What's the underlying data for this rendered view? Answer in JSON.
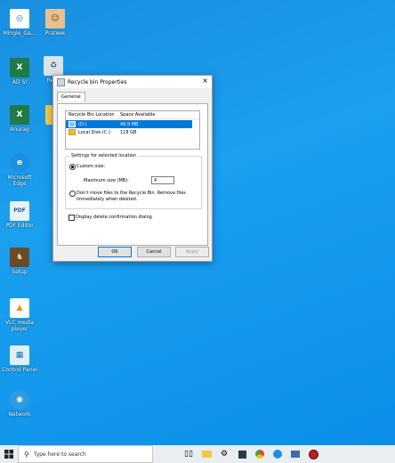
{
  "desktop": {
    "icons": [
      {
        "label": "Mingle_Ga...",
        "glyph": "◎",
        "color": "#ffffff",
        "fg": "#1a6fb5"
      },
      {
        "label": "Prateek",
        "glyph": "☺",
        "color": "#e8c090",
        "fg": "#5a3a1a"
      },
      {
        "label": "AD SI",
        "glyph": "X",
        "color": "#1f7a45",
        "fg": "#ffffff"
      },
      {
        "label": "Recy",
        "glyph": "♻",
        "color": "#d8e4ea",
        "fg": "#556"
      },
      {
        "label": "Anurag",
        "glyph": "X",
        "color": "#1f7a45",
        "fg": "#ffffff"
      },
      {
        "label": "",
        "glyph": "",
        "color": "#f2c94c",
        "fg": "#f2c94c"
      },
      {
        "label": "Microsoft Edge",
        "glyph": "e",
        "color": "#1e8fe0",
        "fg": "#ffffff"
      },
      {
        "label": "PDF Editor",
        "glyph": "PDF",
        "color": "#e8f0fb",
        "fg": "#2b579a"
      },
      {
        "label": "Setup",
        "glyph": "♞",
        "color": "#6b4a2a",
        "fg": "#f0d0a0"
      },
      {
        "label": "VLC media player",
        "glyph": "▲",
        "color": "#ffffff",
        "fg": "#ff8800"
      },
      {
        "label": "Control Panel",
        "glyph": "▦",
        "color": "#dff0fb",
        "fg": "#1a6fb5"
      },
      {
        "label": "Network",
        "glyph": "◉",
        "color": "#2e9be0",
        "fg": "#ffffff"
      }
    ]
  },
  "dialog": {
    "title": "Recycle bin Properties",
    "close_glyph": "×",
    "tab_general": "General",
    "list": {
      "col_location": "Recycle Bin Location",
      "col_space": "Space Available",
      "rows": [
        {
          "location": "(D:)",
          "space": "49.9 MB",
          "selected": true
        },
        {
          "location": "Local Disk (C:)",
          "space": "118 GB",
          "selected": false
        }
      ]
    },
    "settings_group_label": "Settings for selected location",
    "custom_size_label": "Custom size:",
    "max_size_label": "Maximum size (MB):",
    "max_size_value": "4",
    "dont_move_label_1": "Don't move files to the Recycle Bin. Remove files",
    "dont_move_label_2": "immediately when deleted.",
    "confirm_label": "Display delete confirmation dialog",
    "ok_label": "OK",
    "cancel_label": "Cancel",
    "apply_label": "Apply"
  },
  "taskbar": {
    "search_placeholder": "Type here to search",
    "colors": {
      "accent": "#0078d7"
    }
  }
}
